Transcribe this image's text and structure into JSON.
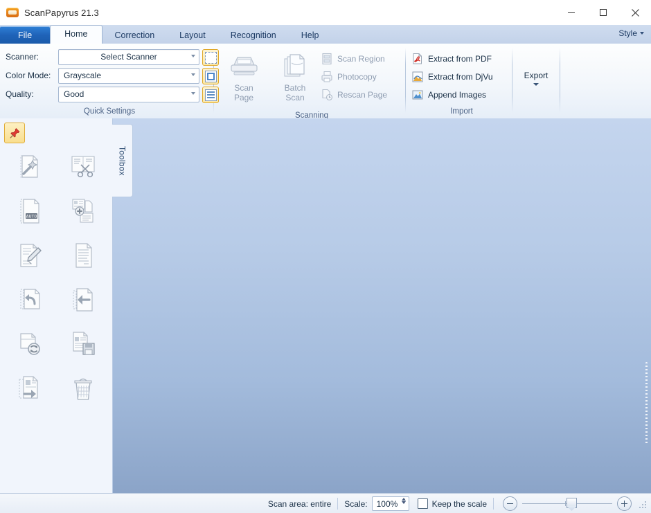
{
  "window": {
    "title": "ScanPapyrus 21.3",
    "app_icon": "scanpapyrus-logo-icon",
    "minimize": "—",
    "maximize": "□",
    "close": "✕"
  },
  "tabs": [
    {
      "label": "File",
      "state": "file"
    },
    {
      "label": "Home",
      "state": "active"
    },
    {
      "label": "Correction",
      "state": "normal"
    },
    {
      "label": "Layout",
      "state": "normal"
    },
    {
      "label": "Recognition",
      "state": "normal"
    },
    {
      "label": "Help",
      "state": "normal"
    }
  ],
  "style_menu": {
    "label": "Style"
  },
  "ribbon": {
    "quick_settings": {
      "caption": "Quick Settings",
      "rows": [
        {
          "label": "Scanner:",
          "value": "Select Scanner",
          "align": "center"
        },
        {
          "label": "Color Mode:",
          "value": "Grayscale",
          "align": "left"
        },
        {
          "label": "Quality:",
          "value": "Good",
          "align": "left"
        }
      ],
      "toggles": [
        {
          "name": "scan-area-dashed-toggle"
        },
        {
          "name": "page-frame-toggle"
        },
        {
          "name": "page-list-toggle"
        }
      ]
    },
    "scanning": {
      "caption": "Scanning",
      "scan_page": {
        "label_line1": "Scan",
        "label_line2": "Page",
        "enabled": false
      },
      "batch_scan": {
        "label_line1": "Batch",
        "label_line2": "Scan",
        "enabled": false
      },
      "small_items": [
        {
          "label": "Scan Region",
          "icon": "scan-region-icon",
          "enabled": false
        },
        {
          "label": "Photocopy",
          "icon": "photocopy-icon",
          "enabled": false
        },
        {
          "label": "Rescan Page",
          "icon": "rescan-page-icon",
          "enabled": false
        }
      ]
    },
    "import": {
      "caption": "Import",
      "items": [
        {
          "label": "Extract from PDF",
          "icon": "pdf-icon",
          "enabled": true
        },
        {
          "label": "Extract from DjVu",
          "icon": "djvu-icon",
          "enabled": true
        },
        {
          "label": "Append Images",
          "icon": "append-images-icon",
          "enabled": true
        }
      ]
    },
    "export": {
      "label": "Export"
    }
  },
  "toolbox": {
    "tab_label": "Toolbox",
    "pin": {
      "name": "pin-toolbox-button",
      "pinned": true
    },
    "tools": [
      {
        "name": "auto-correct-tool",
        "title": "Auto correct page"
      },
      {
        "name": "crop-tool",
        "title": "Crop / cut page"
      },
      {
        "name": "auto-tool",
        "title": "Auto mode"
      },
      {
        "name": "add-page-tool",
        "title": "Add page"
      },
      {
        "name": "edit-page-tool",
        "title": "Edit page"
      },
      {
        "name": "page-text-tool",
        "title": "Page text"
      },
      {
        "name": "rotate-left-tool",
        "title": "Rotate left"
      },
      {
        "name": "move-page-back-tool",
        "title": "Move page back"
      },
      {
        "name": "rescan-tool",
        "title": "Rescan page"
      },
      {
        "name": "save-page-tool",
        "title": "Save page"
      },
      {
        "name": "reorder-pages-tool",
        "title": "Reorder pages"
      },
      {
        "name": "delete-page-tool",
        "title": "Delete page"
      }
    ]
  },
  "status_bar": {
    "scan_area": "Scan area: entire",
    "scale_label": "Scale:",
    "scale_value": "100%",
    "keep_scale_label": "Keep the scale",
    "keep_scale_checked": false,
    "zoom_out": "zoom-out-icon",
    "zoom_in": "zoom-in-icon"
  },
  "colors": {
    "accent_blue": "#1f63b8",
    "tabstrip": "#c7d5ec",
    "canvas_top": "#c4d5ee",
    "canvas_bottom": "#8ba4c8",
    "toolbox_bg": "#f1f5fc",
    "toggle_border": "#e0a92b"
  }
}
